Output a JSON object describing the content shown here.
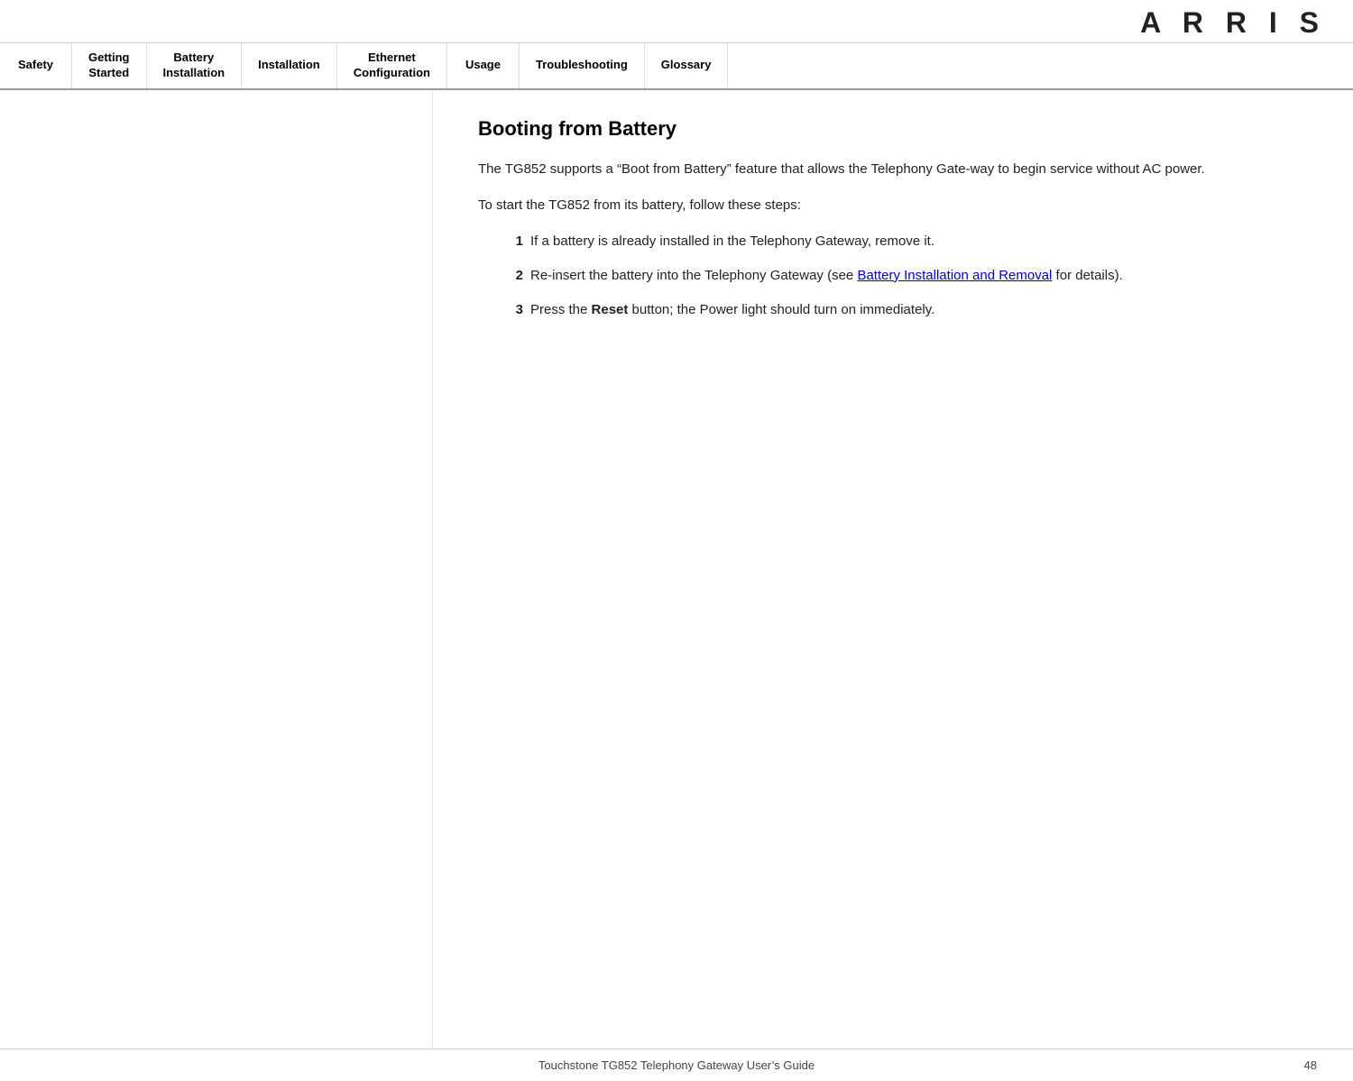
{
  "logo": {
    "text": "A R R I S"
  },
  "nav": {
    "items": [
      {
        "id": "safety",
        "label": "Safety",
        "multiline": false
      },
      {
        "id": "getting-started",
        "label": "Getting\nStarted",
        "multiline": true
      },
      {
        "id": "battery-installation",
        "label": "Battery\nInstallation",
        "multiline": true
      },
      {
        "id": "installation",
        "label": "Installation",
        "multiline": false
      },
      {
        "id": "ethernet-configuration",
        "label": "Ethernet\nConfiguration",
        "multiline": true
      },
      {
        "id": "usage",
        "label": "Usage",
        "multiline": false
      },
      {
        "id": "troubleshooting",
        "label": "Troubleshooting",
        "multiline": false
      },
      {
        "id": "glossary",
        "label": "Glossary",
        "multiline": false
      }
    ]
  },
  "content": {
    "page_title": "Booting from Battery",
    "paragraph1": "The TG852 supports a “Boot from Battery” feature that allows the Telephony Gate-way to begin service without AC power.",
    "paragraph2": "To start the TG852 from its battery, follow these steps:",
    "steps": [
      {
        "number": "1",
        "text": "If a battery is already installed in the Telephony Gateway, remove it."
      },
      {
        "number": "2",
        "text_before": "Re-insert the battery into the Telephony Gateway (see ",
        "link_text": "Battery Installation\nand Removal",
        "text_after": " for details)."
      },
      {
        "number": "3",
        "text_before": "Press the ",
        "bold_text": "Reset",
        "text_after": " button; the Power light should turn on immediately."
      }
    ]
  },
  "footer": {
    "text": "Touchstone TG852 Telephony Gateway User’s Guide",
    "page_number": "48"
  }
}
